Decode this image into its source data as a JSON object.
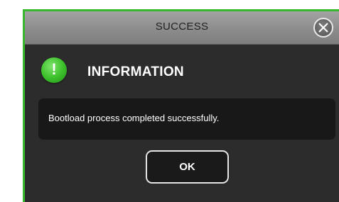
{
  "dialog": {
    "title": "SUCCESS",
    "heading": "INFORMATION",
    "message": "Bootload process completed successfully.",
    "ok_label": "OK",
    "info_icon_glyph": "!",
    "close_icon": "close-icon",
    "info_icon": "exclamation-icon"
  },
  "colors": {
    "accent_border": "#35b82a",
    "icon_green": "#3ec22c",
    "titlebar": "#8c8c8c",
    "dialog_bg": "#2c2c2c",
    "message_bg": "#181818"
  }
}
